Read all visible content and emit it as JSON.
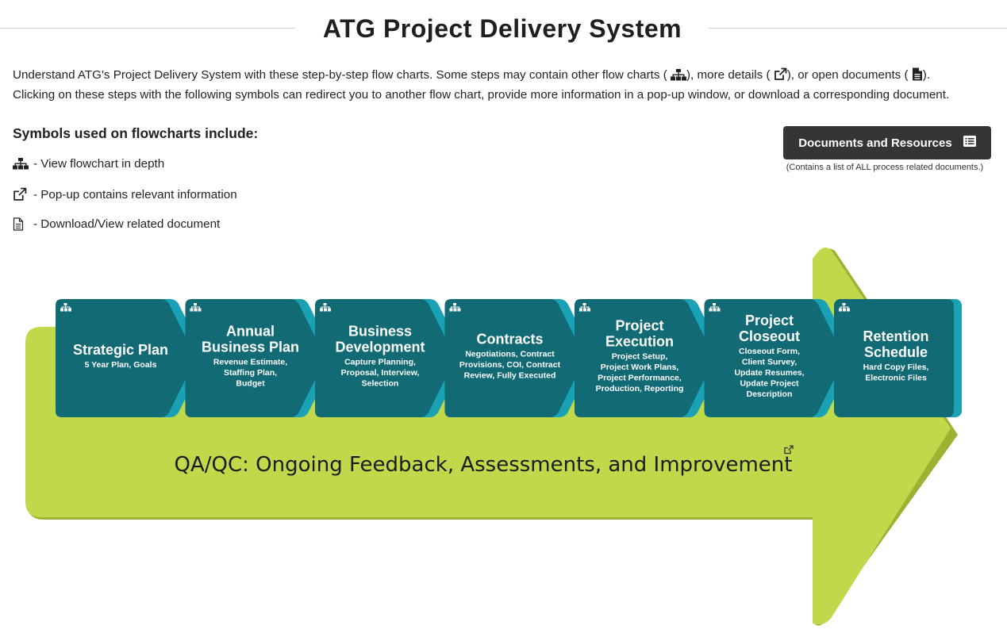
{
  "page": {
    "title": "ATG Project Delivery System",
    "intro": {
      "part1": "Understand ATG's Project Delivery System with these step-by-step flow charts. Some steps may contain other flow charts (",
      "part2": "), more details (",
      "part3": "), or open documents (",
      "part4": ").",
      "line2": "Clicking on these steps with the following symbols can redirect you to another flow chart, provide more information in a pop-up window, or download a corresponding document."
    }
  },
  "symbols": {
    "heading": "Symbols used on flowcharts include:",
    "items": [
      {
        "icon": "sitemap-icon",
        "label": "- View flowchart in depth"
      },
      {
        "icon": "external-link-icon",
        "label": "- Pop-up contains relevant information"
      },
      {
        "icon": "document-icon",
        "label": "- Download/View related document"
      }
    ]
  },
  "resources": {
    "button_label": "Documents and Resources",
    "button_icon": "list-icon",
    "note": "(Contains a list of ALL process related documents.)"
  },
  "diagram": {
    "colors": {
      "arrow": "#bfd94a",
      "arrow_shadow": "#9bb232",
      "step": "#116a74",
      "step_edge": "#1ba1b5"
    },
    "steps": [
      {
        "title": [
          "Strategic Plan"
        ],
        "details": [
          "5 Year Plan, Goals"
        ],
        "icon": "sitemap-icon"
      },
      {
        "title": [
          "Annual",
          "Business Plan"
        ],
        "details": [
          "Revenue Estimate,",
          "Staffing Plan,",
          "Budget"
        ],
        "icon": "sitemap-icon"
      },
      {
        "title": [
          "Business",
          "Development"
        ],
        "details": [
          "Capture Planning,",
          "Proposal, Interview,",
          "Selection"
        ],
        "icon": "sitemap-icon"
      },
      {
        "title": [
          "Contracts"
        ],
        "details": [
          "Negotiations, Contract",
          "Provisions, COI, Contract",
          "Review, Fully Executed"
        ],
        "icon": "sitemap-icon"
      },
      {
        "title": [
          "Project",
          "Execution"
        ],
        "details": [
          "Project Setup,",
          "Project Work Plans,",
          "Project Performance,",
          "Production, Reporting"
        ],
        "icon": "sitemap-icon"
      },
      {
        "title": [
          "Project",
          "Closeout"
        ],
        "details": [
          "Closeout Form,",
          "Client Survey,",
          "Update Resumes,",
          "Update Project",
          "Description"
        ],
        "icon": "sitemap-icon"
      },
      {
        "title": [
          "Retention",
          "Schedule"
        ],
        "details": [
          "Hard Copy Files,",
          "Electronic Files"
        ],
        "icon": "sitemap-icon"
      }
    ],
    "qa_label": "QA/QC: Ongoing Feedback, Assessments, and Improvement",
    "qa_icon": "external-link-icon"
  }
}
